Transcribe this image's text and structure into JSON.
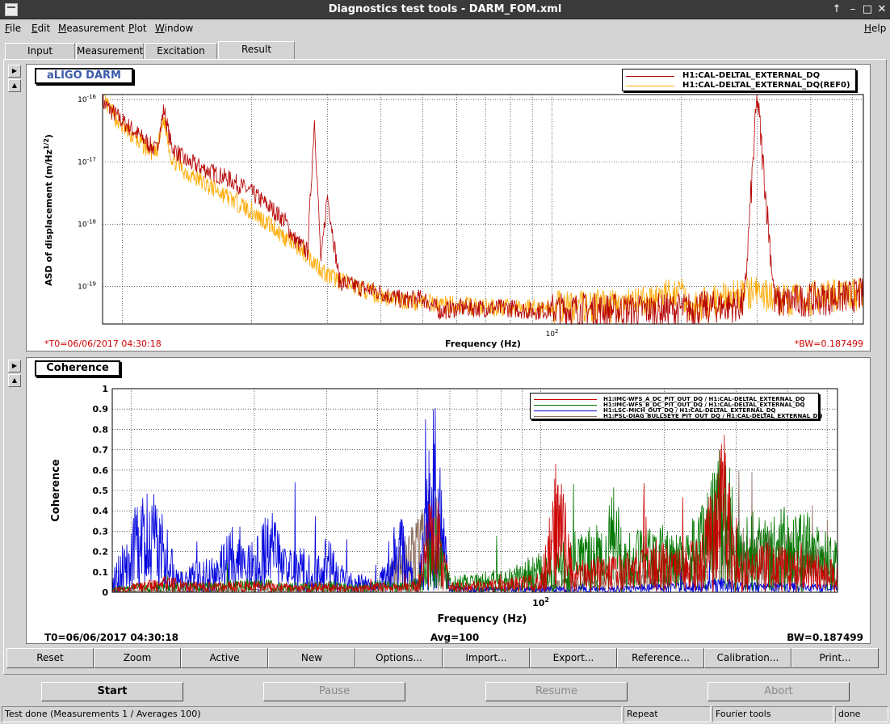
{
  "window": {
    "title": "Diagnostics test tools - DARM_FOM.xml",
    "controls": [
      "↑",
      "–",
      "□",
      "✕"
    ]
  },
  "menubar": {
    "items": [
      {
        "label": "File",
        "key": "F",
        "rest": "ile"
      },
      {
        "label": "Edit",
        "key": "E",
        "rest": "dit"
      },
      {
        "label": "Measurement",
        "key": "M",
        "rest": "easurement"
      },
      {
        "label": "Plot",
        "key": "P",
        "rest": "lot"
      },
      {
        "label": "Window",
        "key": "W",
        "rest": "indow"
      }
    ],
    "help": {
      "key": "H",
      "rest": "elp"
    }
  },
  "tabs": [
    {
      "label": "Input"
    },
    {
      "label": "Measurement"
    },
    {
      "label": "Excitation"
    },
    {
      "label": "Result",
      "active": true
    }
  ],
  "plot1": {
    "label": "aLIGO DARM",
    "legend": [
      {
        "name": "H1:CAL-DELTAL_EXTERNAL_DQ",
        "color": "#b50000"
      },
      {
        "name": "H1:CAL-DELTAL_EXTERNAL_DQ(REF0)",
        "color": "#ffaa00"
      }
    ],
    "ylabel": "ASD of displacement (m/Hz",
    "ylabel_sup": "1/2",
    "ylabel_end": ")",
    "xlabel": "Frequency (Hz)",
    "t0": "*T0=06/06/2017 04:30:18",
    "bw": "*BW=0.187499"
  },
  "plot2": {
    "label": "Coherence",
    "legend": [
      {
        "name": "H1:IMC-WFS_A_DC_PIT_OUT_DQ / H1:CAL-DELTAL_EXTERNAL_DQ",
        "color": "#cc0000"
      },
      {
        "name": "H1:IMC-WFS_B_DC_PIT_OUT_DQ / H1:CAL-DELTAL_EXTERNAL_DQ",
        "color": "#007700"
      },
      {
        "name": "H1:LSC-MICH_OUT_DQ / H1:CAL-DELTAL_EXTERNAL_DQ",
        "color": "#0000dd"
      },
      {
        "name": "H1:PSL-DIAG_BULLSEYE_PIT_OUT_DQ / H1:CAL-DELTAL_EXTERNAL_DQ",
        "color": "#8b6b5b"
      }
    ],
    "ylabel": "Coherence",
    "xlabel": "Frequency (Hz)",
    "t0": "T0=06/06/2017 04:30:18",
    "avg": "Avg=100",
    "bw": "BW=0.187499"
  },
  "chart_data": [
    {
      "type": "line",
      "title": "aLIGO DARM",
      "xlabel": "Frequency (Hz)",
      "ylabel": "ASD of displacement (m/Hz^1/2)",
      "x_scale": "log",
      "y_scale": "log",
      "xlim": [
        9,
        530
      ],
      "ylim": [
        2.5e-20,
        1.2e-16
      ],
      "x_tick_label": "10^2",
      "y_tick_labels": [
        "10^-16",
        "10^-17",
        "10^-18",
        "10^-19"
      ],
      "grid": true,
      "legend_position": "top-right",
      "series": [
        {
          "name": "H1:CAL-DELTAL_EXTERNAL_DQ",
          "x": [
            9,
            10,
            11,
            12,
            12.5,
            13,
            14,
            16,
            18,
            20,
            22,
            24,
            25,
            27,
            28,
            29,
            30,
            32,
            35,
            40,
            45,
            50,
            55,
            60,
            70,
            80,
            90,
            100,
            120,
            140,
            160,
            180,
            200,
            220,
            250,
            280,
            300,
            330,
            360,
            400,
            450,
            500,
            530
          ],
          "y": [
            9e-17,
            4.5e-17,
            2.6e-17,
            1.5e-17,
            7e-17,
            1.8e-17,
            1.05e-17,
            7e-18,
            5e-18,
            3.2e-18,
            1.9e-18,
            1.1e-18,
            6e-19,
            3.6e-19,
            5e-17,
            2.3e-19,
            3e-18,
            1.2e-19,
            1e-19,
            8e-20,
            6e-20,
            6.5e-20,
            4e-20,
            4.5e-20,
            4.5e-20,
            4.5e-20,
            4e-20,
            4.3e-20,
            4.3e-20,
            4.2e-20,
            4.2e-20,
            4.2e-20,
            4.3e-20,
            4.5e-20,
            4.8e-20,
            5e-20,
            1.2e-16,
            5.5e-20,
            5.8e-20,
            6.2e-20,
            6.5e-20,
            7e-20,
            7.5e-20
          ]
        },
        {
          "name": "H1:CAL-DELTAL_EXTERNAL_DQ(REF0)",
          "x": [
            9,
            10,
            11,
            12,
            12.5,
            13,
            14,
            16,
            18,
            20,
            22,
            24,
            26,
            28,
            30,
            35,
            40,
            45,
            50,
            60,
            70,
            80,
            100,
            120,
            150,
            180,
            200,
            210,
            220,
            250,
            300,
            330,
            360,
            400,
            450,
            500,
            530
          ],
          "y": [
            1e-16,
            3.6e-17,
            2e-17,
            1.3e-17,
            5e-17,
            1.2e-17,
            7e-18,
            4e-18,
            2.5e-18,
            1.6e-18,
            1e-18,
            6e-19,
            4e-19,
            2.5e-19,
            1.5e-19,
            1e-19,
            7e-20,
            6e-20,
            5.5e-20,
            5e-20,
            4.6e-20,
            4.5e-20,
            4.6e-20,
            4.8e-20,
            5e-20,
            6.5e-20,
            9e-20,
            4.5e-20,
            5e-20,
            6.5e-20,
            8e-20,
            6.5e-20,
            6e-20,
            6.5e-20,
            7e-20,
            7.5e-20,
            8e-20
          ]
        }
      ]
    },
    {
      "type": "line",
      "title": "Coherence",
      "xlabel": "Frequency (Hz)",
      "ylabel": "Coherence",
      "x_scale": "log",
      "xlim": [
        9,
        530
      ],
      "ylim": [
        0,
        1
      ],
      "x_tick_label": "10^2",
      "y_ticks": [
        0,
        0.1,
        0.2,
        0.3,
        0.4,
        0.5,
        0.6,
        0.7,
        0.8,
        0.9,
        1
      ],
      "grid": true,
      "legend_position": "top-right",
      "series": [
        {
          "name": "H1:IMC-WFS_A_DC_PIT_OUT_DQ / H1:CAL-DELTAL_EXTERNAL_DQ",
          "x": [
            9,
            12,
            15,
            20,
            25,
            30,
            35,
            40,
            45,
            50,
            55,
            60,
            70,
            80,
            100,
            110,
            120,
            140,
            160,
            180,
            200,
            220,
            250,
            270,
            280,
            290,
            300,
            330,
            360,
            400,
            450,
            500,
            530
          ],
          "y": [
            0.02,
            0.08,
            0.05,
            0.06,
            0.04,
            0.05,
            0.03,
            0.05,
            0.04,
            0.06,
            0.6,
            0.05,
            0.06,
            0.07,
            0.1,
            0.72,
            0.15,
            0.18,
            0.2,
            0.22,
            0.25,
            0.2,
            0.35,
            0.68,
            0.82,
            0.5,
            0.2,
            0.22,
            0.25,
            0.22,
            0.2,
            0.18,
            0.15
          ]
        },
        {
          "name": "H1:IMC-WFS_B_DC_PIT_OUT_DQ / H1:CAL-DELTAL_EXTERNAL_DQ",
          "x": [
            9,
            12,
            15,
            20,
            25,
            30,
            35,
            40,
            45,
            50,
            55,
            60,
            70,
            80,
            100,
            120,
            140,
            150,
            160,
            180,
            200,
            220,
            250,
            270,
            280,
            290,
            300,
            330,
            360,
            400,
            450,
            500,
            530
          ],
          "y": [
            0.03,
            0.06,
            0.05,
            0.07,
            0.05,
            0.06,
            0.04,
            0.06,
            0.05,
            0.08,
            0.4,
            0.08,
            0.1,
            0.12,
            0.2,
            0.3,
            0.35,
            0.56,
            0.3,
            0.32,
            0.35,
            0.3,
            0.45,
            0.75,
            0.8,
            0.6,
            0.35,
            0.4,
            0.38,
            0.45,
            0.4,
            0.3,
            0.25
          ]
        },
        {
          "name": "H1:LSC-MICH_OUT_DQ / H1:CAL-DELTAL_EXTERNAL_DQ",
          "x": [
            9,
            10,
            11,
            12,
            13,
            14,
            16,
            18,
            20,
            22,
            24,
            26,
            28,
            30,
            33,
            36,
            40,
            45,
            50,
            55,
            60,
            70,
            80,
            100,
            150,
            200,
            250,
            280,
            300,
            400,
            530
          ],
          "y": [
            0.1,
            0.35,
            0.54,
            0.4,
            0.1,
            0.15,
            0.2,
            0.35,
            0.25,
            0.44,
            0.2,
            0.25,
            0.15,
            0.3,
            0.12,
            0.1,
            0.05,
            0.44,
            0.05,
            1.0,
            0.04,
            0.03,
            0.03,
            0.03,
            0.03,
            0.05,
            0.06,
            0.08,
            0.05,
            0.05,
            0.04
          ]
        },
        {
          "name": "H1:PSL-DIAG_BULLSEYE_PIT_OUT_DQ / H1:CAL-DELTAL_EXTERNAL_DQ",
          "x": [
            9,
            20,
            30,
            40,
            55,
            60,
            80,
            100,
            150,
            200,
            250,
            280,
            300,
            330,
            360,
            400,
            450,
            500,
            530
          ],
          "y": [
            0.01,
            0.02,
            0.02,
            0.02,
            0.56,
            0.02,
            0.03,
            0.05,
            0.1,
            0.15,
            0.2,
            0.4,
            0.35,
            0.3,
            0.3,
            0.3,
            0.25,
            0.2,
            0.18
          ]
        }
      ]
    }
  ],
  "toolbar": [
    "Reset",
    "Zoom",
    "Active",
    "New",
    "Options...",
    "Import...",
    "Export...",
    "Reference...",
    "Calibration...",
    "Print..."
  ],
  "actions": [
    {
      "label": "Start",
      "enabled": true
    },
    {
      "label": "Pause",
      "enabled": false
    },
    {
      "label": "Resume",
      "enabled": false
    },
    {
      "label": "Abort",
      "enabled": false
    }
  ],
  "status": {
    "message": "Test done (Measurements 1 / Averages 100)",
    "repeat": "Repeat",
    "tool": "Fourier tools",
    "state": "done"
  }
}
